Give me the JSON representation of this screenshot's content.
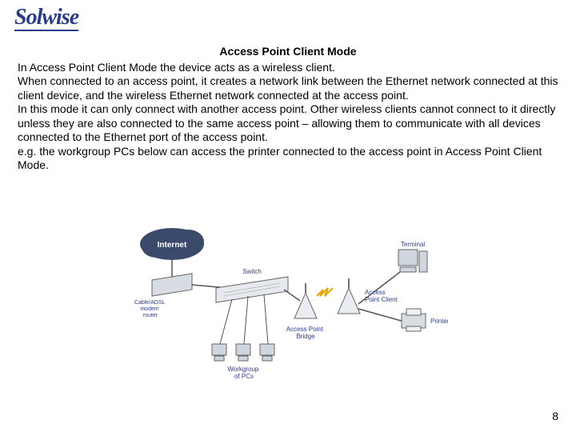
{
  "brand": "Solwise",
  "title": "Access Point Client Mode",
  "paragraphs": [
    "In Access Point Client Mode the device acts as a wireless client.",
    "When connected to an access point, it creates a network link between the Ethernet network connected at this client device, and the wireless Ethernet network connected at the access point.",
    "In this mode it can only connect with another access point. Other wireless clients cannot connect to it directly unless they are also connected to the same access point – allowing them to communicate with all devices connected to the Ethernet port of the access point.",
    "e.g. the workgroup PCs below can access the printer connected to the access point in Access Point Client Mode."
  ],
  "page_number": "8",
  "diagram": {
    "internet": "Internet",
    "cable_router": "Cable/ADSL\nmodem\nrouter",
    "switch": "Switch",
    "ap_bridge": "Access Point\nBridge",
    "ap_client": "Access\nPoint Client",
    "terminal": "Terminal",
    "printer": "Printer",
    "workgroup": "Workgroup\nof PCs"
  }
}
